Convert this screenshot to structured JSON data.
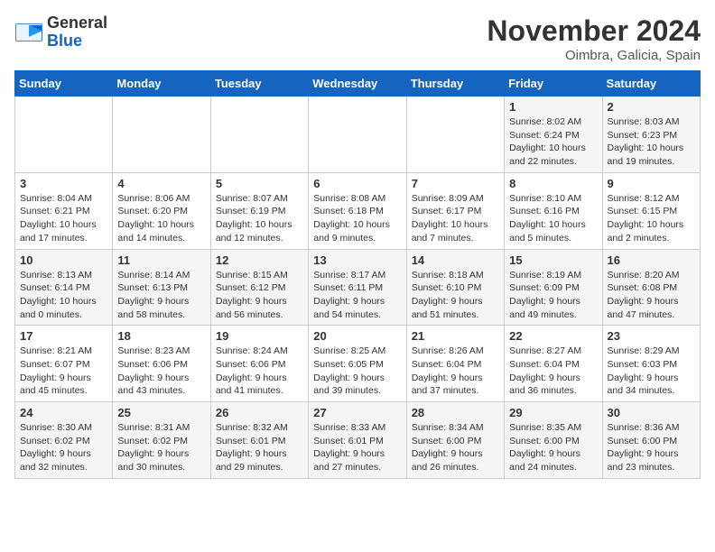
{
  "logo": {
    "general": "General",
    "blue": "Blue"
  },
  "title": "November 2024",
  "location": "Oimbra, Galicia, Spain",
  "days_of_week": [
    "Sunday",
    "Monday",
    "Tuesday",
    "Wednesday",
    "Thursday",
    "Friday",
    "Saturday"
  ],
  "weeks": [
    [
      {
        "day": "",
        "info": ""
      },
      {
        "day": "",
        "info": ""
      },
      {
        "day": "",
        "info": ""
      },
      {
        "day": "",
        "info": ""
      },
      {
        "day": "",
        "info": ""
      },
      {
        "day": "1",
        "info": "Sunrise: 8:02 AM\nSunset: 6:24 PM\nDaylight: 10 hours and 22 minutes."
      },
      {
        "day": "2",
        "info": "Sunrise: 8:03 AM\nSunset: 6:23 PM\nDaylight: 10 hours and 19 minutes."
      }
    ],
    [
      {
        "day": "3",
        "info": "Sunrise: 8:04 AM\nSunset: 6:21 PM\nDaylight: 10 hours and 17 minutes."
      },
      {
        "day": "4",
        "info": "Sunrise: 8:06 AM\nSunset: 6:20 PM\nDaylight: 10 hours and 14 minutes."
      },
      {
        "day": "5",
        "info": "Sunrise: 8:07 AM\nSunset: 6:19 PM\nDaylight: 10 hours and 12 minutes."
      },
      {
        "day": "6",
        "info": "Sunrise: 8:08 AM\nSunset: 6:18 PM\nDaylight: 10 hours and 9 minutes."
      },
      {
        "day": "7",
        "info": "Sunrise: 8:09 AM\nSunset: 6:17 PM\nDaylight: 10 hours and 7 minutes."
      },
      {
        "day": "8",
        "info": "Sunrise: 8:10 AM\nSunset: 6:16 PM\nDaylight: 10 hours and 5 minutes."
      },
      {
        "day": "9",
        "info": "Sunrise: 8:12 AM\nSunset: 6:15 PM\nDaylight: 10 hours and 2 minutes."
      }
    ],
    [
      {
        "day": "10",
        "info": "Sunrise: 8:13 AM\nSunset: 6:14 PM\nDaylight: 10 hours and 0 minutes."
      },
      {
        "day": "11",
        "info": "Sunrise: 8:14 AM\nSunset: 6:13 PM\nDaylight: 9 hours and 58 minutes."
      },
      {
        "day": "12",
        "info": "Sunrise: 8:15 AM\nSunset: 6:12 PM\nDaylight: 9 hours and 56 minutes."
      },
      {
        "day": "13",
        "info": "Sunrise: 8:17 AM\nSunset: 6:11 PM\nDaylight: 9 hours and 54 minutes."
      },
      {
        "day": "14",
        "info": "Sunrise: 8:18 AM\nSunset: 6:10 PM\nDaylight: 9 hours and 51 minutes."
      },
      {
        "day": "15",
        "info": "Sunrise: 8:19 AM\nSunset: 6:09 PM\nDaylight: 9 hours and 49 minutes."
      },
      {
        "day": "16",
        "info": "Sunrise: 8:20 AM\nSunset: 6:08 PM\nDaylight: 9 hours and 47 minutes."
      }
    ],
    [
      {
        "day": "17",
        "info": "Sunrise: 8:21 AM\nSunset: 6:07 PM\nDaylight: 9 hours and 45 minutes."
      },
      {
        "day": "18",
        "info": "Sunrise: 8:23 AM\nSunset: 6:06 PM\nDaylight: 9 hours and 43 minutes."
      },
      {
        "day": "19",
        "info": "Sunrise: 8:24 AM\nSunset: 6:06 PM\nDaylight: 9 hours and 41 minutes."
      },
      {
        "day": "20",
        "info": "Sunrise: 8:25 AM\nSunset: 6:05 PM\nDaylight: 9 hours and 39 minutes."
      },
      {
        "day": "21",
        "info": "Sunrise: 8:26 AM\nSunset: 6:04 PM\nDaylight: 9 hours and 37 minutes."
      },
      {
        "day": "22",
        "info": "Sunrise: 8:27 AM\nSunset: 6:04 PM\nDaylight: 9 hours and 36 minutes."
      },
      {
        "day": "23",
        "info": "Sunrise: 8:29 AM\nSunset: 6:03 PM\nDaylight: 9 hours and 34 minutes."
      }
    ],
    [
      {
        "day": "24",
        "info": "Sunrise: 8:30 AM\nSunset: 6:02 PM\nDaylight: 9 hours and 32 minutes."
      },
      {
        "day": "25",
        "info": "Sunrise: 8:31 AM\nSunset: 6:02 PM\nDaylight: 9 hours and 30 minutes."
      },
      {
        "day": "26",
        "info": "Sunrise: 8:32 AM\nSunset: 6:01 PM\nDaylight: 9 hours and 29 minutes."
      },
      {
        "day": "27",
        "info": "Sunrise: 8:33 AM\nSunset: 6:01 PM\nDaylight: 9 hours and 27 minutes."
      },
      {
        "day": "28",
        "info": "Sunrise: 8:34 AM\nSunset: 6:00 PM\nDaylight: 9 hours and 26 minutes."
      },
      {
        "day": "29",
        "info": "Sunrise: 8:35 AM\nSunset: 6:00 PM\nDaylight: 9 hours and 24 minutes."
      },
      {
        "day": "30",
        "info": "Sunrise: 8:36 AM\nSunset: 6:00 PM\nDaylight: 9 hours and 23 minutes."
      }
    ]
  ]
}
